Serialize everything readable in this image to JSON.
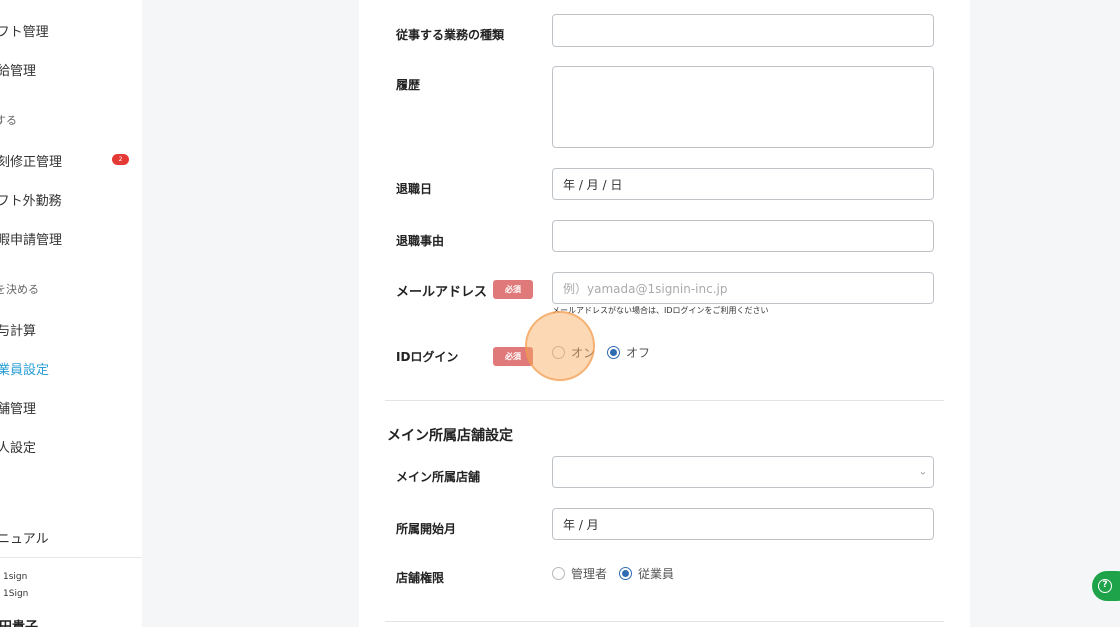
{
  "sidebar": {
    "items": [
      {
        "label": "ンフト管理"
      },
      {
        "label": "有給管理"
      },
      {
        "label": "打刻修正管理"
      },
      {
        "label": "ンフト外勤務"
      },
      {
        "label": "休暇申請管理"
      },
      {
        "label": "給与計算"
      },
      {
        "label": "従業員設定"
      },
      {
        "label": "店舗管理"
      },
      {
        "label": "法人設定"
      },
      {
        "label": "マニュアル"
      }
    ],
    "sections": [
      "をする",
      "ルを決める"
    ],
    "badge_count": "2",
    "company_lines": [
      "1sign",
      "1Sign"
    ],
    "user_name": "西田貴子"
  },
  "form": {
    "job_type": {
      "label": "従事する業務の種類",
      "value": ""
    },
    "history": {
      "label": "履歴",
      "value": ""
    },
    "retirement_date": {
      "label": "退職日",
      "value": "年 / 月 / 日"
    },
    "retirement_reason": {
      "label": "退職事由",
      "value": ""
    },
    "email": {
      "label": "メールアドレス",
      "required_badge": "必須",
      "placeholder": "例）yamada@1signin-inc.jp",
      "hint": "メールアドレスがない場合は、IDログインをご利用ください"
    },
    "id_login": {
      "label": "IDログイン",
      "required_badge": "必須",
      "options": [
        {
          "label": "オン",
          "checked": false
        },
        {
          "label": "オフ",
          "checked": true
        }
      ]
    }
  },
  "main_store_section": {
    "title": "メイン所属店舗設定",
    "main_store": {
      "label": "メイン所属店舗",
      "value": ""
    },
    "start_month": {
      "label": "所属開始月",
      "value": "年 / 月"
    },
    "store_permission": {
      "label": "店舗権限",
      "options": [
        {
          "label": "管理者",
          "checked": false
        },
        {
          "label": "従業員",
          "checked": true
        }
      ]
    }
  },
  "help_button": {
    "icon": "question-icon",
    "label": "?"
  },
  "colors": {
    "accent": "#2a9fd6",
    "required_badge": "#e07a7a",
    "radio_selected": "#2f6bb0",
    "help_button": "#1fa34a",
    "badge": "#e53935"
  }
}
